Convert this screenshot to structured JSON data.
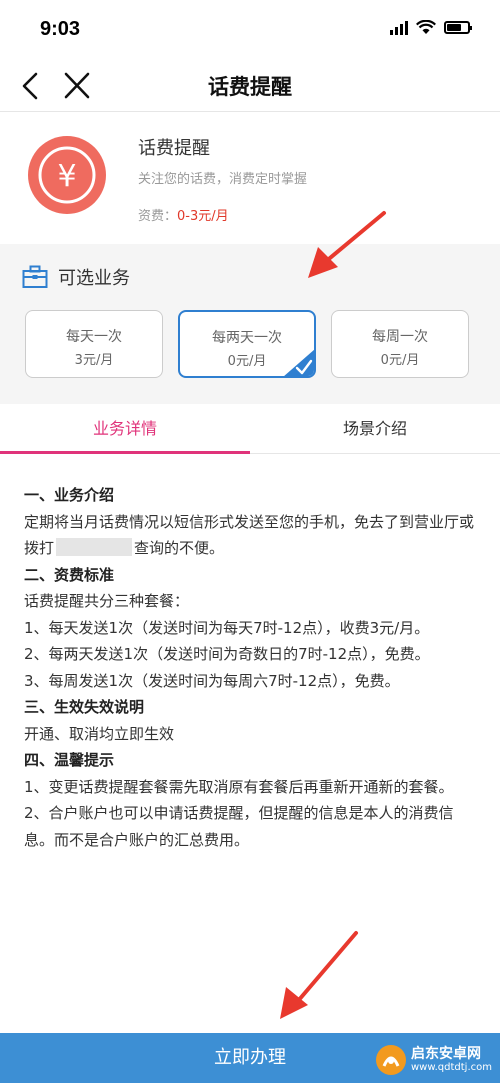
{
  "status_bar": {
    "time": "9:03"
  },
  "nav": {
    "title": "话费提醒"
  },
  "product": {
    "name": "话费提醒",
    "description": "关注您的话费，消费定时掌握",
    "fee_label": "资费：",
    "fee_value": "0-3元/月",
    "icon_symbol": "¥",
    "icon_color": "#ef6b5f"
  },
  "options": {
    "title": "可选业务",
    "items": [
      {
        "name": "每天一次",
        "price": "3元/月",
        "selected": false
      },
      {
        "name": "每两天一次",
        "price": "0元/月",
        "selected": true
      },
      {
        "name": "每周一次",
        "price": "0元/月",
        "selected": false
      }
    ]
  },
  "tabs": [
    {
      "label": "业务详情",
      "active": true
    },
    {
      "label": "场景介绍",
      "active": false
    }
  ],
  "details": {
    "s1_title": "一、业务介绍",
    "s1_text_a": "定期将当月话费情况以短信形式发送至您的手机，免去了到营业厅或拨打",
    "s1_text_b": "查询的不便。",
    "s2_title": "二、资费标准",
    "s2_intro": "话费提醒共分三种套餐：",
    "s2_item1": "1、每天发送1次（发送时间为每天7时-12点），收费3元/月。",
    "s2_item2": "2、每两天发送1次（发送时间为奇数日的7时-12点），免费。",
    "s2_item3": "3、每周发送1次（发送时间为每周六7时-12点），免费。",
    "s3_title": "三、生效失效说明",
    "s3_text": "开通、取消均立即生效",
    "s4_title": "四、温馨提示",
    "s4_item1": "1、变更话费提醒套餐需先取消原有套餐后再重新开通新的套餐。",
    "s4_item2": "2、合户账户也可以申请话费提醒，但提醒的信息是本人的消费信息。而不是合户账户的汇总费用。"
  },
  "action": {
    "label": "立即办理"
  },
  "watermark": {
    "main": "启东安卓网",
    "sub": "www.qdtdtj.com"
  },
  "colors": {
    "accent_blue": "#3d8fd4",
    "tab_pink": "#e0337a",
    "fee_red": "#e0392a",
    "arrow_red": "#e8392e"
  }
}
